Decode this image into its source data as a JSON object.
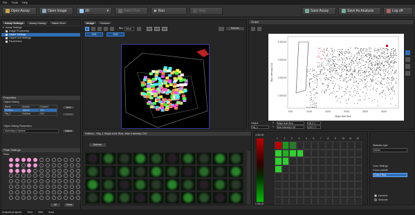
{
  "menu": [
    "File",
    "Tools",
    "Help"
  ],
  "toolbar": {
    "open_assay": "Open Assay",
    "open_image": "Open Image",
    "view_mode": "3D",
    "batch_run": "Batch Run",
    "run": "Run",
    "stop": "Stop",
    "save_assay": "Save Assay",
    "save_as_analysis": "Save As Analysis",
    "log_off": "Log off"
  },
  "left": {
    "tabs": [
      "Assay Settings",
      "Assay Gating",
      "Batch Run"
    ],
    "tree_title": "Assay Settings",
    "tree": [
      "Image Processing",
      "Object Settings",
      "Object Unit Settings",
      "Parameters"
    ],
    "properties_title": "Properties",
    "object_setting_label": "Object Setting",
    "table_head": [
      "Name",
      "Module",
      "Channel"
    ],
    "table_rows": [
      [
        "Nucleus",
        "Sphere",
        "Ch1"
      ],
      [
        "Obj_1",
        "Nucleus",
        "Ch2"
      ]
    ],
    "btn_new": "New",
    "btn_delete": "Delete",
    "params_label": "Object Setting Parameters",
    "params_value": "MainObject Sphere",
    "btn_adjust": "Adjust",
    "plate_settings": "Plate Settings",
    "plate_label": "Plate",
    "btn_all": "All",
    "btn_clear": "Clear",
    "range_settings": "Range Settings"
  },
  "image": {
    "tabs": [
      "Image",
      "Volume"
    ],
    "blur_label": "Blur",
    "blur_value": "None",
    "refresh": "Refresh",
    "channels": [
      "CH1",
      "CH2"
    ]
  },
  "graph": {
    "title": "Graph",
    "ylabel": "Max Intensity Ch2",
    "xlabel": "Major Axis Size",
    "y_ticks": [
      "4 000.00",
      "3 000.00",
      "2 000.00",
      "1 000.00"
    ],
    "x_ticks": [
      "5.00",
      "10.00",
      "15.00",
      "20.00",
      "25.00",
      "30.00"
    ],
    "object_label": "Object",
    "object_value": "Obj_1",
    "x_axis_label": "X",
    "x_axis_value": "Major Axis Size",
    "y_axis_label": "Y",
    "y_axis_value": "Max Intensity Ch2",
    "x_scale": "LIN X 1",
    "y_scale": "LOG Y 1"
  },
  "gallery": {
    "title": "Gallery - Obj_1 Major Axis Size, Max Intensity Ch2",
    "refresh": "Refresh"
  },
  "heatmap": {
    "top_label": "4 000.00",
    "bottom_label": "1 000.00",
    "cols": [
      "1",
      "2",
      "3",
      "4",
      "5",
      "6",
      "7",
      "8",
      "9",
      "10",
      "11",
      "12"
    ],
    "rows": [
      "A",
      "B",
      "C",
      "D",
      "E",
      "F",
      "G",
      "H"
    ]
  },
  "right_settings": {
    "statistics_label": "Statistics type",
    "statistics_value": "Mean",
    "color_settings_label": "Color Settings",
    "color_palette_label": "Colour palette",
    "color_palette_value": "Green Red",
    "radio_dynamic": "Dynamic",
    "radio_absolute": "Absolute"
  },
  "status": {
    "progress_label": "Analysis progress",
    "time_label": "Time",
    "well_label": "Well",
    "area_label": "Area"
  },
  "colors": {
    "selected": "#2e6fb7",
    "well_on": "#f29bd6"
  }
}
